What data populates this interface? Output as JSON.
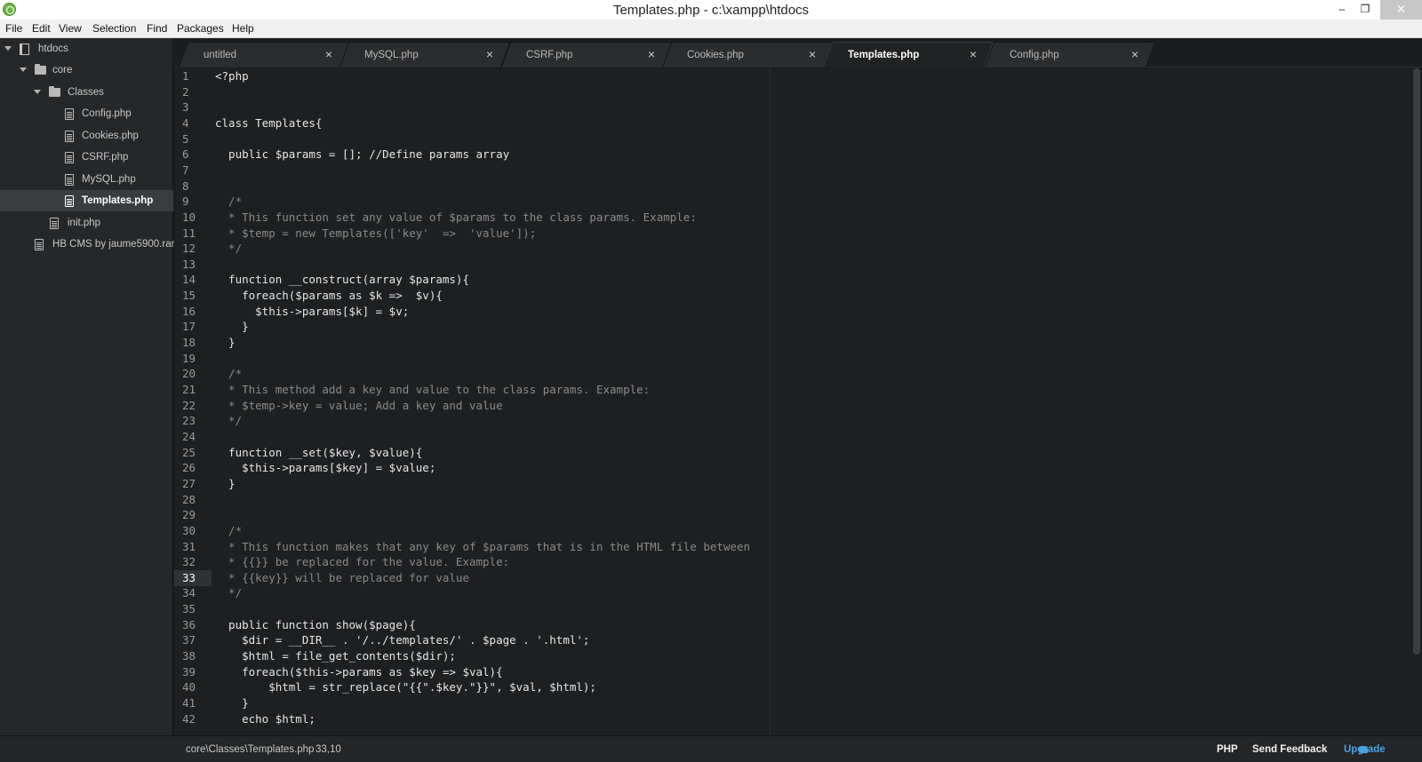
{
  "window": {
    "title": "Templates.php - c:\\xampp\\htdocs",
    "minimize_glyph": "–",
    "maximize_glyph": "❐",
    "close_glyph": "✕"
  },
  "menu": [
    "File",
    "Edit",
    "View",
    "Selection",
    "Find",
    "Packages",
    "Help"
  ],
  "sidebar": {
    "items": [
      {
        "label": "htdocs",
        "type": "repo",
        "expanded": true
      },
      {
        "label": "core",
        "type": "folder",
        "expanded": true
      },
      {
        "label": "Classes",
        "type": "folder",
        "expanded": true
      },
      {
        "label": "Config.php",
        "type": "file"
      },
      {
        "label": "Cookies.php",
        "type": "file"
      },
      {
        "label": "CSRF.php",
        "type": "file"
      },
      {
        "label": "MySQL.php",
        "type": "file"
      },
      {
        "label": "Templates.php",
        "type": "file",
        "selected": true
      },
      {
        "label": "init.php",
        "type": "file"
      },
      {
        "label": "HB CMS by jaume5900.rar",
        "type": "file"
      }
    ]
  },
  "tabs": [
    {
      "label": "untitled",
      "close": "×"
    },
    {
      "label": "MySQL.php",
      "close": "×"
    },
    {
      "label": "CSRF.php",
      "close": "×"
    },
    {
      "label": "Cookies.php",
      "close": "×"
    },
    {
      "label": "Templates.php",
      "close": "×",
      "active": true
    },
    {
      "label": "Config.php",
      "close": "×"
    }
  ],
  "editor": {
    "current_line": 33,
    "lines": [
      "<?php",
      "",
      "",
      "class Templates{",
      "",
      "  public $params = []; //Define params array",
      "",
      "",
      "  /*",
      "  * This function set any value of $params to the class params. Example:",
      "  * $temp = new Templates(['key'  =>  'value']);",
      "  */",
      "",
      "  function __construct(array $params){",
      "    foreach($params as $k =>  $v){",
      "      $this->params[$k] = $v;",
      "    }",
      "  }",
      "",
      "  /*",
      "  * This method add a key and value to the class params. Example:",
      "  * $temp->key = value; Add a key and value",
      "  */",
      "",
      "  function __set($key, $value){",
      "    $this->params[$key] = $value;",
      "  }",
      "",
      "",
      "  /*",
      "  * This function makes that any key of $params that is in the HTML file between",
      "  * {{}} be replaced for the value. Example:",
      "  * {{key}} will be replaced for value",
      "  */",
      "",
      "  public function show($page){",
      "    $dir = __DIR__ . '/../templates/' . $page . '.html';",
      "    $html = file_get_contents($dir);",
      "    foreach($this->params as $key => $val){",
      "        $html = str_replace(\"{{\".$key.\"}}\", $val, $html);",
      "    }",
      "    echo $html;"
    ],
    "line_numbers": [
      "1",
      "2",
      "3",
      "4",
      "5",
      "6",
      "7",
      "8",
      "9",
      "10",
      "11",
      "12",
      "13",
      "14",
      "15",
      "16",
      "17",
      "18",
      "19",
      "20",
      "21",
      "22",
      "23",
      "24",
      "25",
      "26",
      "27",
      "28",
      "29",
      "30",
      "31",
      "32",
      "33",
      "34",
      "35",
      "36",
      "37",
      "38",
      "39",
      "40",
      "41",
      "42"
    ]
  },
  "status": {
    "file_path": "core\\Classes\\Templates.php",
    "cursor": "33,10",
    "grammar": "PHP",
    "feedback": "Send Feedback",
    "upgrade": "Upgrade"
  },
  "colors": {
    "accent": "#4aa3df",
    "editor_bg": "#1d1f21",
    "sidebar_bg": "#252729"
  }
}
